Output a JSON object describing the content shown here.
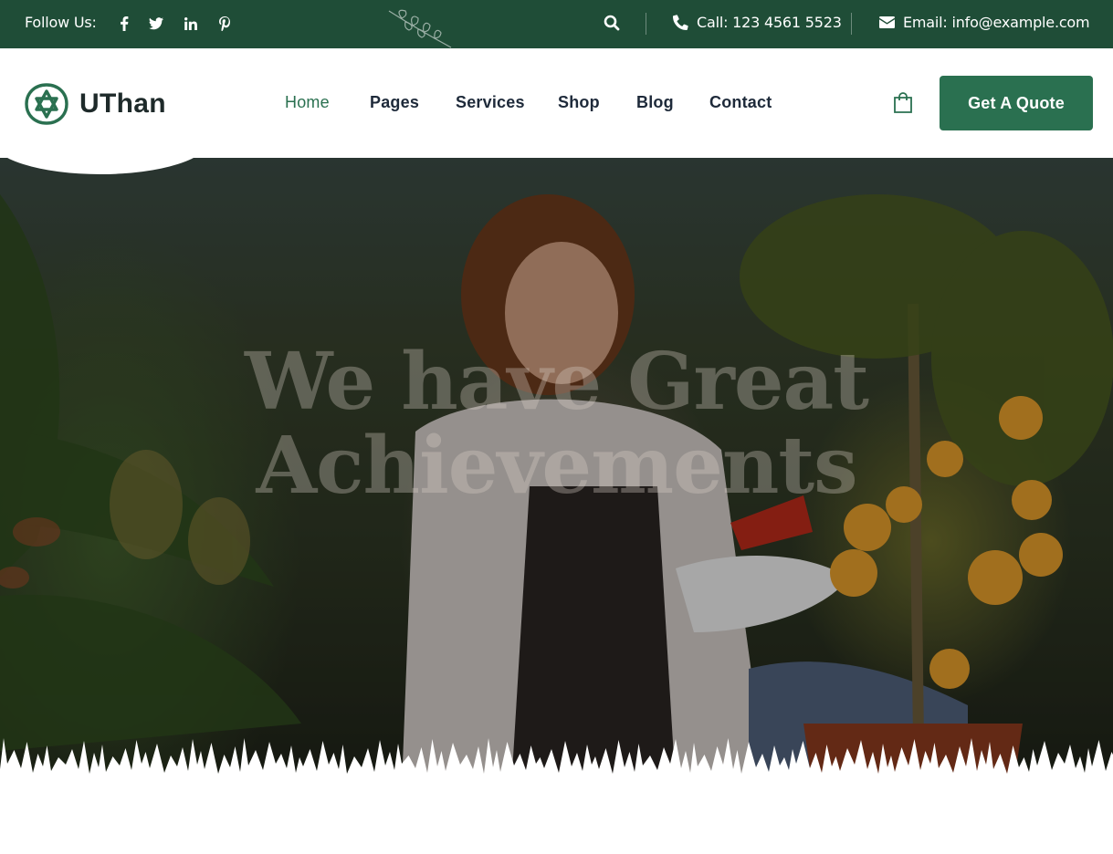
{
  "topbar": {
    "follow_label": "Follow Us:",
    "socials": [
      "facebook-icon",
      "twitter-icon",
      "linkedin-icon",
      "pinterest-icon"
    ],
    "phone": "Call: 123 4561 5523",
    "email": "Email: info@example.com"
  },
  "brand": {
    "name": "UThan"
  },
  "nav": {
    "items": [
      "Home",
      "Pages",
      "Services",
      "Shop",
      "Blog",
      "Contact"
    ],
    "active": "Home",
    "quote_label": "Get A Quote"
  },
  "hero": {
    "title_line1": "We have Great",
    "title_line2": "Achievements"
  },
  "colors": {
    "primary_dark": "#1f4d37",
    "accent": "#2a7050",
    "text_dark": "#1e2a3a"
  }
}
